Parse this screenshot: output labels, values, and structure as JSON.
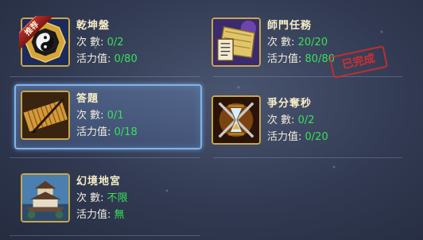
{
  "labels": {
    "count": "次數",
    "energy": "活力值"
  },
  "activities": [
    {
      "name": "乾坤盤",
      "count_label": "次  數:",
      "count": "0/2",
      "energy_label": "活力值:",
      "energy": "0/80",
      "badge": "推荐",
      "icon": "bagua-icon"
    },
    {
      "name": "師門任務",
      "count_label": "次  數:",
      "count": "20/20",
      "energy_label": "活力值:",
      "energy": "80/80",
      "stamp": "已完成",
      "icon": "scroll-map-icon"
    },
    {
      "name": "答題",
      "count_label": "次  數:",
      "count": "0/1",
      "energy_label": "活力值:",
      "energy": "0/18",
      "selected": true,
      "icon": "bamboo-scroll-icon"
    },
    {
      "name": "爭分奪秒",
      "count_label": "次  數:",
      "count": "0/2",
      "energy_label": "活力值:",
      "energy": "0/20",
      "icon": "hourglass-swords-icon"
    },
    {
      "name": "幻境地宮",
      "count_label": "次  數:",
      "count": "不限",
      "energy_label": "活力值:",
      "energy": "無",
      "icon": "palace-icon"
    }
  ],
  "colors": {
    "value_green": "#39e05a",
    "title_cream": "#f6eec7",
    "selected_border": "#7fb4ea",
    "stamp_red": "#e22e2e"
  }
}
